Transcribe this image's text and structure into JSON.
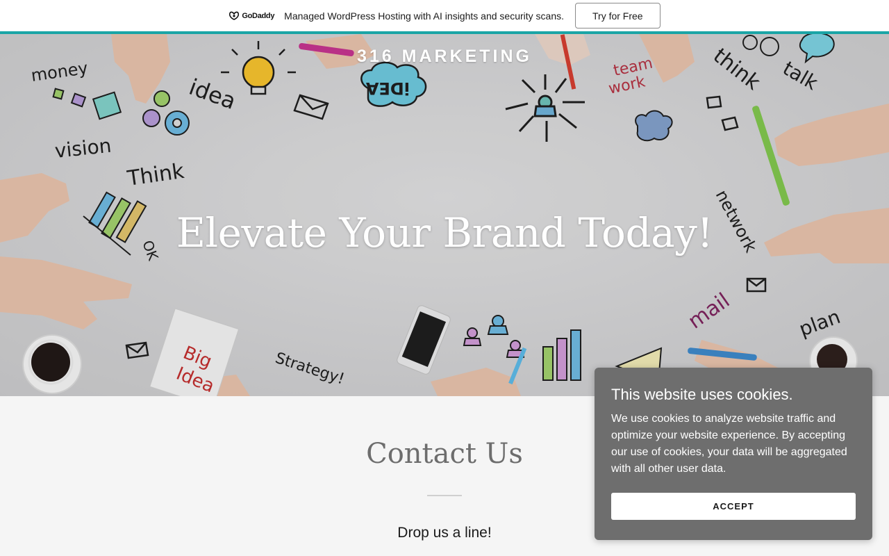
{
  "promo": {
    "logo_text": "GoDaddy",
    "message": "Managed WordPress Hosting with AI insights and security scans.",
    "cta_label": "Try for Free",
    "accent_color": "#1ba5a6"
  },
  "hero": {
    "brand": "316 MARKETING",
    "title": "Elevate Your Brand Today!",
    "doodle_words": {
      "money": "money",
      "idea": "idea",
      "idea_cloud": "iDEA",
      "team": "team",
      "work": "work",
      "think_top": "think",
      "talk": "talk",
      "vision": "vision",
      "think_left": "Think",
      "ok": "OK",
      "network": "network",
      "mail": "mail",
      "plan": "plan",
      "big": "Big",
      "idea_card": "Idea",
      "strategy": "Strategy!"
    }
  },
  "contact": {
    "title": "Contact Us",
    "subtitle": "Drop us a line!"
  },
  "cookie": {
    "title": "This website uses cookies.",
    "body": "We use cookies to analyze website traffic and optimize your website experience. By accepting our use of cookies, your data will be aggregated with all other user data.",
    "accept_label": "ACCEPT"
  }
}
